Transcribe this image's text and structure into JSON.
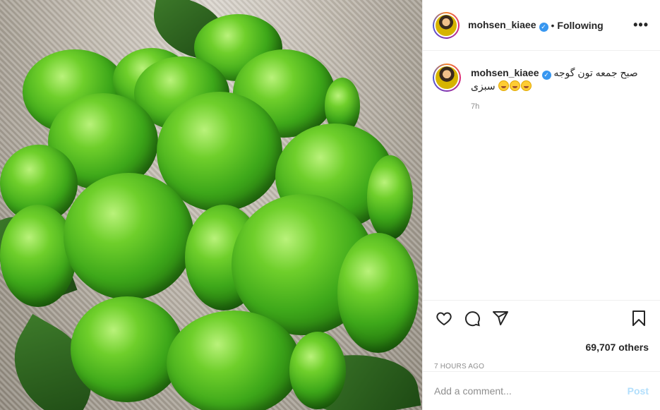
{
  "post": {
    "username": "mohsen_kiaee",
    "verified": true,
    "follow_status": "Following",
    "separator": "•",
    "more_label": "•••"
  },
  "caption": {
    "username": "mohsen_kiaee",
    "text": "صبح جمعه تون گوجه سبزی",
    "emojis": [
      "yum-emoji",
      "grin-emoji",
      "wink-emoji"
    ],
    "time": "7h"
  },
  "actions": {
    "icons": [
      "heart-icon",
      "comment-icon",
      "share-icon",
      "bookmark-icon"
    ],
    "likes": "69,707 others",
    "posted_ago": "7 HOURS AGO"
  },
  "comment": {
    "placeholder": "Add a comment...",
    "post_label": "Post"
  },
  "colors": {
    "verified_blue": "#3897f0",
    "post_disabled": "#b2dffc",
    "muted_text": "#8e8e8e",
    "border": "#efefef"
  }
}
